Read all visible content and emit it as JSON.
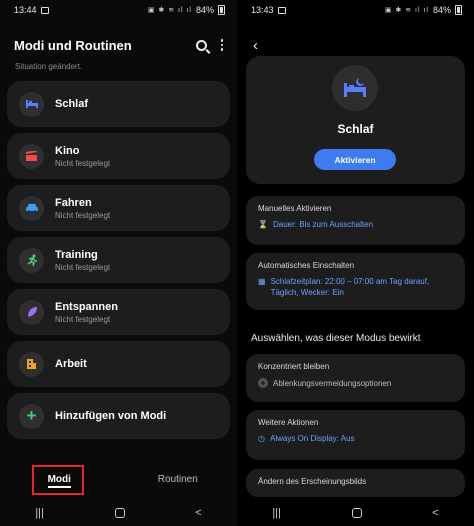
{
  "left": {
    "status": {
      "time": "13:44",
      "battery": "84%"
    },
    "header": {
      "title": "Modi und Routinen"
    },
    "subtitle": "Situation geändert.",
    "modes": [
      {
        "name": "Schlaf",
        "icon": "bed-icon",
        "status": "",
        "color": "#5a7cff"
      },
      {
        "name": "Kino",
        "icon": "clapperboard-icon",
        "status": "Nicht festgelegt",
        "color": "#f2494c"
      },
      {
        "name": "Fahren",
        "icon": "car-icon",
        "status": "Nicht festgelegt",
        "color": "#3ba0f5"
      },
      {
        "name": "Training",
        "icon": "running-icon",
        "status": "Nicht festgelegt",
        "color": "#54d37a"
      },
      {
        "name": "Entspannen",
        "icon": "leaf-icon",
        "status": "Nicht festgelegt",
        "color": "#a070f0"
      },
      {
        "name": "Arbeit",
        "icon": "building-icon",
        "status": "",
        "color": "#f5a030"
      },
      {
        "name": "Hinzufügen von Modi",
        "icon": "plus-icon",
        "status": "",
        "color": "#4ecb71"
      }
    ],
    "tabs": {
      "active": "Modi",
      "other": "Routinen"
    }
  },
  "right": {
    "status": {
      "time": "13:43",
      "battery": "84%"
    },
    "mode_title": "Schlaf",
    "activate_label": "Aktivieren",
    "manual": {
      "title": "Manuelles Aktivieren",
      "value": "Dauer: Bis zum Ausschalten"
    },
    "auto": {
      "title": "Automatisches Einschalten",
      "value_line1": "Schlafzeitplan: 22:00 – 07:00 am Tag darauf,",
      "value_line2": "Täglich, Wecker: Ein"
    },
    "section_title": "Auswählen, was dieser Modus bewirkt",
    "focus": {
      "title": "Konzentriert bleiben",
      "value": "Ablenkungsvermeidungsoptionen"
    },
    "more": {
      "title": "Weitere Aktionen",
      "value": "Always On Display: Aus"
    },
    "appearance": {
      "title": "Ändern des Erscheinungsbilds"
    }
  }
}
